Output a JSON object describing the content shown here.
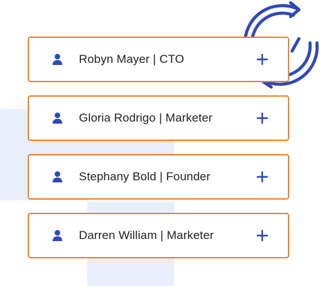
{
  "people": [
    {
      "label": "Robyn Mayer | CTO",
      "icon": "person-icon",
      "action_icon": "plus-icon"
    },
    {
      "label": "Gloria Rodrigo | Marketer",
      "icon": "person-icon",
      "action_icon": "plus-icon"
    },
    {
      "label": "Stephany Bold | Founder",
      "icon": "person-icon",
      "action_icon": "plus-icon"
    },
    {
      "label": "Darren William | Marketer",
      "icon": "person-icon",
      "action_icon": "plus-icon"
    }
  ],
  "decoration": {
    "icon": "sync-icon"
  },
  "colors": {
    "accent_border": "#f0842c",
    "icon_blue": "#2f4ab5",
    "background_block": "#e9eefb"
  }
}
